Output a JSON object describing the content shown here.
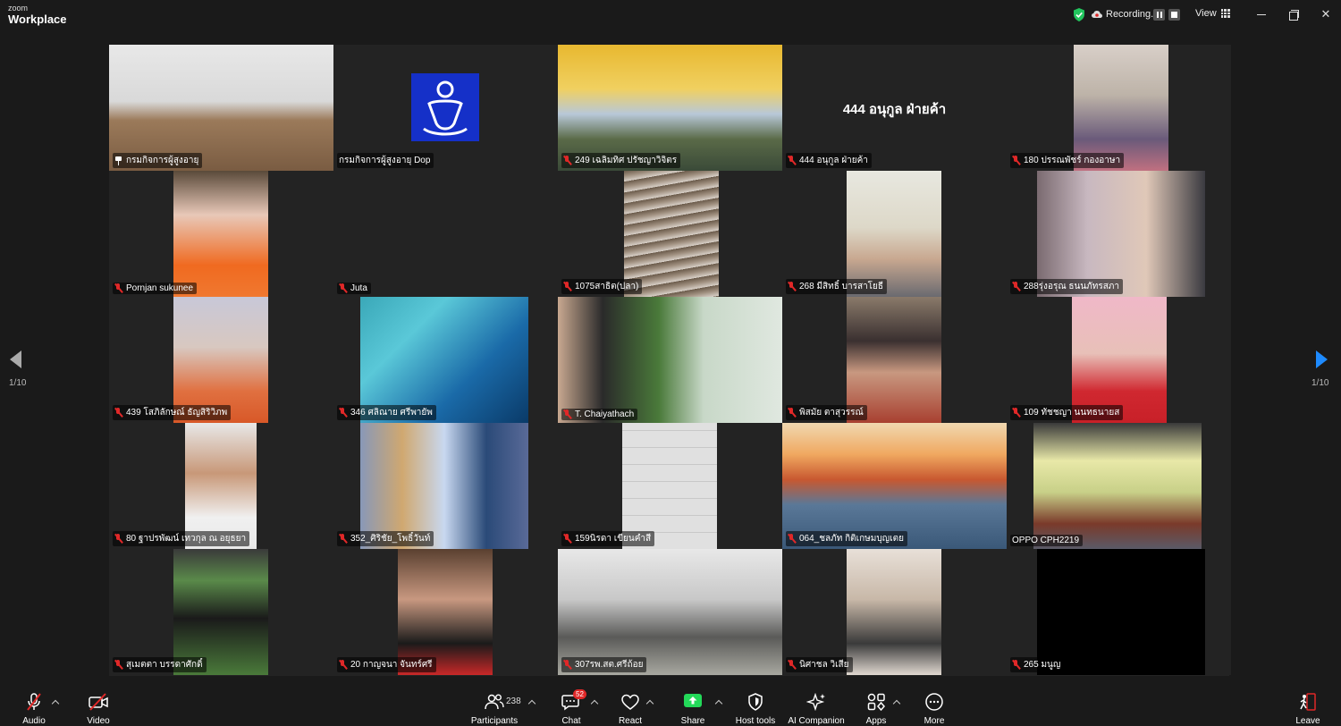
{
  "app": {
    "logo_small": "zoom",
    "logo_main": "Workplace"
  },
  "titlebar": {
    "recording_label": "Recording...",
    "view_label": "View"
  },
  "pagination": {
    "left": "1/10",
    "right": "1/10"
  },
  "participants": [
    {
      "name": "กรมกิจการผู้สูงอายุ",
      "pinned": true,
      "active": true,
      "video": "meeting"
    },
    {
      "name": "กรมกิจการผู้สูงอายุ Dop",
      "muted": false,
      "video": "logo"
    },
    {
      "name": "249 เฉลิมทิศ ปรัชญาวิจิตร",
      "muted": true,
      "video": "pagoda"
    },
    {
      "name": "444 อนุกูล ฝ่ายค้า",
      "muted": true,
      "video": "none",
      "big_name": "444 อนุกูล ฝ่ายค้า"
    },
    {
      "name": "180 ปรรณพัชร์ กองอาษา",
      "muted": true,
      "video": "person-scarf"
    },
    {
      "name": "Pornjan sukunee",
      "muted": true,
      "video": "person-orange"
    },
    {
      "name": "Juta",
      "muted": true,
      "video": "fox"
    },
    {
      "name": "1075สาธิต(ปลา)",
      "muted": true,
      "video": "stairs"
    },
    {
      "name": "268 มีสิทธิ์ บารสาโยธี",
      "muted": true,
      "video": "old-man"
    },
    {
      "name": "288รุ่งอรุณ ธนนภัทรสภา",
      "muted": true,
      "video": "woman-glasses"
    },
    {
      "name": "439 โสภิลักษณ์ ธัญสิริวิภพ",
      "muted": true,
      "video": "woman-curtain"
    },
    {
      "name": "346 ศลิณาย ศรีพายัพ",
      "muted": true,
      "video": "blue-gradient"
    },
    {
      "name": "T. Chaiyathach",
      "muted": true,
      "video": "man-statue"
    },
    {
      "name": "พิสมัย ตาสุวรรณ์",
      "muted": true,
      "video": "woman-reading"
    },
    {
      "name": "109 ทัชชญา นนทธนายส",
      "muted": true,
      "video": "woman-red"
    },
    {
      "name": "80 ฐาปรพัฒน์ เทวกุล ณ อยุธยา",
      "muted": true,
      "video": "woman-white"
    },
    {
      "name": "352_ศิริชัย_โพธิ์วันท์",
      "muted": true,
      "video": "man-window"
    },
    {
      "name": "159นิรดา เขียนคำสี",
      "muted": true,
      "video": "ceiling"
    },
    {
      "name": "064_ชลภัท กิติเกษมบุญเตย",
      "muted": true,
      "video": "golden-gate"
    },
    {
      "name": "OPPO CPH2219",
      "muted": false,
      "video": "room-window"
    },
    {
      "name": "สุเมตตา บรรดาศักดิ์",
      "muted": true,
      "video": "fan"
    },
    {
      "name": "20 กาญจนา จันทร์ศรี",
      "muted": true,
      "video": "woman-earphones"
    },
    {
      "name": "307รพ.สต.ศรีถ้อย",
      "muted": true,
      "video": "group-room"
    },
    {
      "name": "นิศาชล วิเสีย",
      "muted": true,
      "video": "office"
    },
    {
      "name": "265 มนูญ",
      "muted": true,
      "video": "black"
    }
  ],
  "toolbar": {
    "audio": "Audio",
    "video": "Video",
    "participants": "Participants",
    "participants_count": "238",
    "chat": "Chat",
    "chat_badge": "52",
    "react": "React",
    "share": "Share",
    "host_tools": "Host tools",
    "ai_companion": "AI Companion",
    "apps": "Apps",
    "more": "More",
    "leave": "Leave"
  },
  "colors": {
    "active_border": "#23d959",
    "muted_red": "#e02828",
    "share_green": "#23d959",
    "accent_blue": "#1e8bff"
  }
}
